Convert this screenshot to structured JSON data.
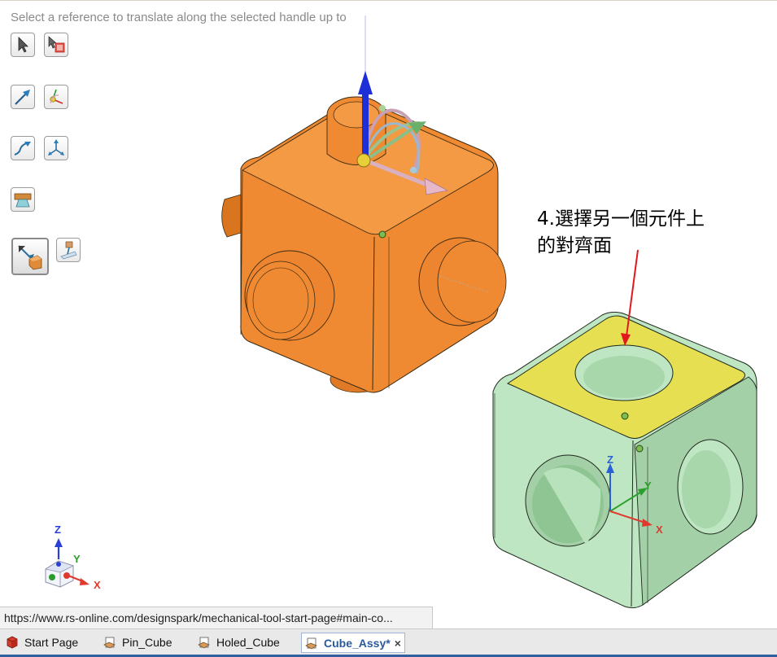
{
  "viewport": {
    "hint_text": "Select a reference to translate along the selected handle up to",
    "annotation_line1": "4.選擇另一個元件上",
    "annotation_line2": "的對齊面"
  },
  "toolbar": {
    "tools": [
      {
        "icon": "select-arrow-icon"
      },
      {
        "icon": "select-component-icon"
      },
      {
        "icon": "direction-arrow-icon"
      },
      {
        "icon": "anchor-point-icon"
      },
      {
        "icon": "move-along-path-icon"
      },
      {
        "icon": "pivot-icon"
      },
      {
        "icon": "ruler-dimension-icon"
      },
      {
        "icon": "up-to-reference-icon"
      },
      {
        "icon": "options-icon"
      }
    ]
  },
  "scene": {
    "pin_cube_color": "#f08a32",
    "holed_cube_color": "#bfe6c2",
    "selected_face_color": "#e6df52",
    "annotation_arrow_color": "#e0191e",
    "triad_labels": {
      "z": "Z",
      "y": "Y",
      "x": "X"
    },
    "corner_triad_labels": {
      "z": "Z",
      "y": "Y",
      "x": "X"
    },
    "axis_colors": {
      "x": "#e03a2f",
      "y": "#2aa02a",
      "z": "#2a3fd8"
    }
  },
  "status": {
    "url": "https://www.rs-online.com/designspark/mechanical-tool-start-page#main-co..."
  },
  "tabs": [
    {
      "label": "Start Page",
      "icon": "start-page-icon",
      "active": false
    },
    {
      "label": "Pin_Cube",
      "icon": "design-icon",
      "active": false
    },
    {
      "label": "Holed_Cube",
      "icon": "design-icon",
      "active": false
    },
    {
      "label": "Cube_Assy*",
      "icon": "design-icon",
      "active": true,
      "close": "×"
    }
  ]
}
